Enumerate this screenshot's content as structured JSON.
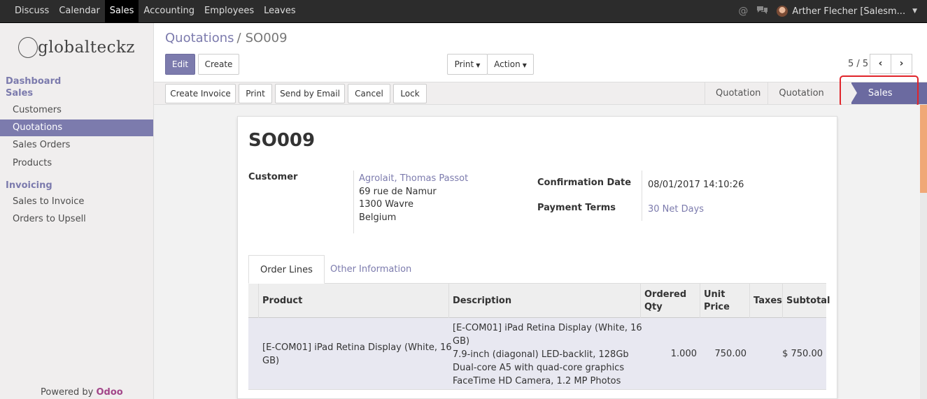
{
  "topbar": {
    "menu": [
      "Discuss",
      "Calendar",
      "Sales",
      "Accounting",
      "Employees",
      "Leaves"
    ],
    "active_menu": "Sales",
    "user": "Arther Flecher [Salesm..."
  },
  "sidebar": {
    "logo_text": "globalteckz",
    "section_dashboard": "Dashboard",
    "section_sales": "Sales",
    "sales_items": [
      "Customers",
      "Quotations",
      "Sales Orders",
      "Products"
    ],
    "section_invoicing": "Invoicing",
    "invoicing_items": [
      "Sales to Invoice",
      "Orders to Upsell"
    ],
    "powered_by": "Powered by",
    "powered_brand": "Odoo"
  },
  "breadcrumb": {
    "parent": "Quotations",
    "separator": "/",
    "current": "SO009"
  },
  "control": {
    "edit": "Edit",
    "create": "Create",
    "print": "Print",
    "action": "Action",
    "pager": "5 / 5"
  },
  "statusbar": {
    "buttons": [
      "Create Invoice",
      "Print",
      "Send by Email",
      "Cancel",
      "Lock"
    ],
    "stages": [
      "Quotation",
      "Quotation Sent",
      "Sales Order"
    ],
    "active_stage": "Sales Order"
  },
  "form": {
    "title": "SO009",
    "customer_label": "Customer",
    "customer_name": "Agrolait, Thomas Passot",
    "address": [
      "69 rue de Namur",
      "1300 Wavre",
      "Belgium"
    ],
    "confirmation_label": "Confirmation Date",
    "confirmation_value": "08/01/2017 14:10:26",
    "payment_label": "Payment Terms",
    "payment_value": "30 Net Days",
    "tabs": [
      "Order Lines",
      "Other Information"
    ]
  },
  "table": {
    "headers": {
      "product": "Product",
      "description": "Description",
      "qty": [
        "Ordered",
        "Qty"
      ],
      "price": [
        "Unit",
        "Price"
      ],
      "taxes": "Taxes",
      "subtotal": "Subtotal"
    },
    "rows": [
      {
        "product": [
          "[E-COM01] iPad Retina Display (White, 16",
          "GB)"
        ],
        "description": [
          "[E-COM01] iPad Retina Display (White, 16",
          "GB)",
          "7.9-inch (diagonal) LED-backlit, 128Gb",
          "Dual-core A5 with quad-core graphics",
          "FaceTime HD Camera, 1.2 MP Photos"
        ],
        "qty": "1.000",
        "price": "750.00",
        "taxes": "",
        "subtotal": "$ 750.00"
      }
    ]
  },
  "colors": {
    "brand": "#7c7bad",
    "highlight": "#e0242a",
    "odoo": "#a24689"
  }
}
